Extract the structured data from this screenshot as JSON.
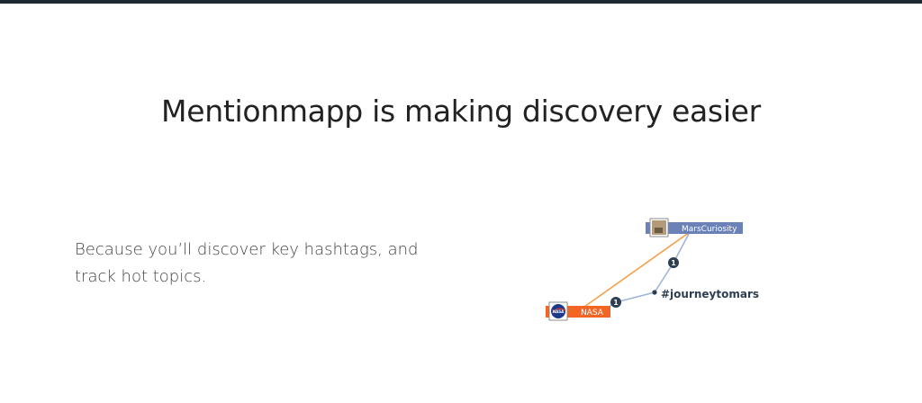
{
  "header": {
    "title": "Mentionmapp is making discovery easier"
  },
  "main": {
    "description": "Because you’ll discover key hashtags, and track hot topics."
  },
  "graph": {
    "nodes": {
      "mars": {
        "label": "MarsCuriosity",
        "color": "#6a82b8"
      },
      "nasa": {
        "label": "NASA",
        "color": "#f26522",
        "badge": "NASA"
      },
      "hashtag": {
        "label": "#journeytomars"
      }
    },
    "edges": {
      "mars_hashtag_count": "1",
      "nasa_hashtag_count": "1"
    },
    "colors": {
      "nasa_mars_link": "#f5a04a",
      "hashtag_link": "#9fb5d6",
      "count_badge": "#2c3e50"
    }
  }
}
